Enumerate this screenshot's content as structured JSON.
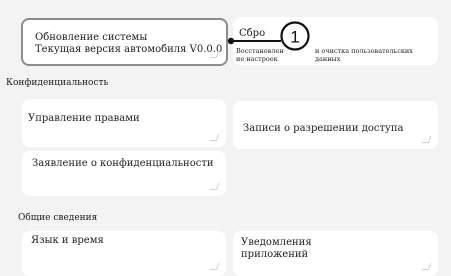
{
  "system_update": {
    "title": "Обновление системы",
    "version": "Текущая версия автомобиля V0.0.0"
  },
  "reset": {
    "title": "Сбро",
    "desc_line1": "Восстановлен",
    "desc_line2": "ие настроек",
    "desc_right_line1": "и очистка пользовательских",
    "desc_right_line2": "данных"
  },
  "callout": {
    "number": "1"
  },
  "sections": {
    "privacy": "Конфиденциальность",
    "general": "Общие сведения"
  },
  "privacy_cards": {
    "rights": "Управление правами",
    "access_records": "Записи о разрешении доступа",
    "privacy_statement": "Заявление о конфиденциальности"
  },
  "general_cards": {
    "language_time": "Язык и время",
    "app_notifications_line1": "Уведомления",
    "app_notifications_line2": "приложений"
  }
}
